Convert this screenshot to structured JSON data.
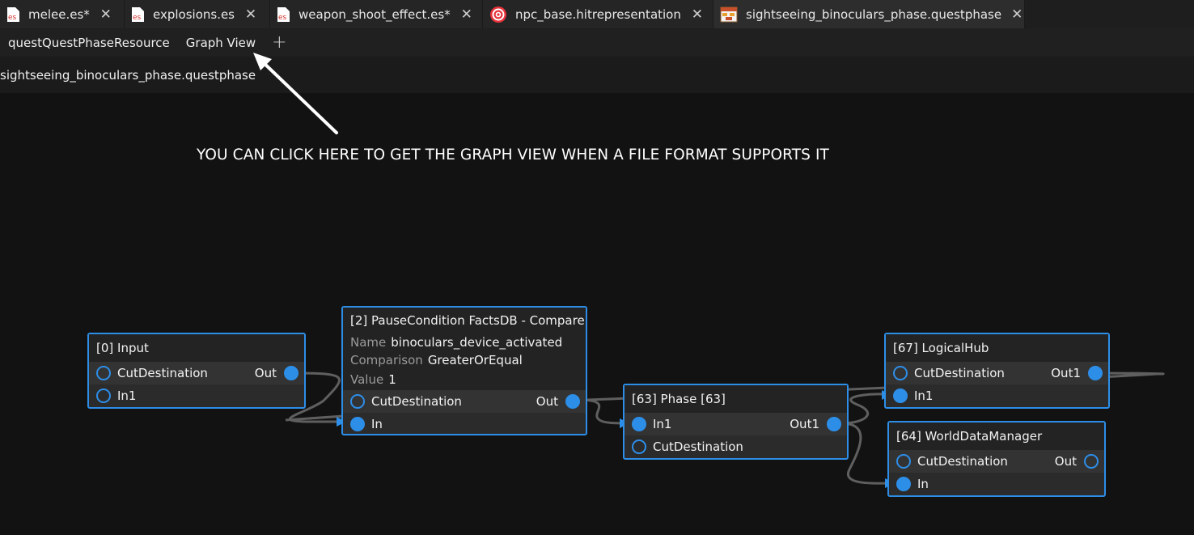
{
  "tabs": [
    {
      "label": "melee.es*",
      "icon": "es-file-icon",
      "active": false
    },
    {
      "label": "explosions.es",
      "icon": "es-file-icon",
      "active": false
    },
    {
      "label": "weapon_shoot_effect.es*",
      "icon": "es-file-icon",
      "active": false
    },
    {
      "label": "npc_base.hitrepresentation",
      "icon": "target-icon",
      "active": false
    },
    {
      "label": "sightseeing_binoculars_phase.questphase",
      "icon": "questphase-icon",
      "active": true
    }
  ],
  "es_icon_text": "es",
  "toolbar": {
    "resource_label": "questQuestPhaseResource",
    "graph_view_label": "Graph View",
    "add_label": "+"
  },
  "path": "sightseeing_binoculars_phase.questphase",
  "annotation": "YOU CAN CLICK HERE TO GET THE GRAPH VIEW WHEN A FILE FORMAT SUPPORTS IT",
  "colors": {
    "accent": "#2d8ee8",
    "background": "#121212",
    "wire": "#5a5a5a"
  },
  "nodes": {
    "input": {
      "title": "[0] Input",
      "rows": [
        {
          "left": "CutDestination",
          "right": "Out"
        },
        {
          "left": "In1",
          "right": ""
        }
      ]
    },
    "pause": {
      "title": "[2] PauseCondition FactsDB - Compare",
      "props": [
        {
          "key": "Name",
          "value": "binoculars_device_activated"
        },
        {
          "key": "Comparison",
          "value": "GreaterOrEqual"
        },
        {
          "key": "Value",
          "value": "1"
        }
      ],
      "rows": [
        {
          "left": "CutDestination",
          "right": "Out"
        },
        {
          "left": "In",
          "right": ""
        }
      ]
    },
    "phase": {
      "title": "[63] Phase [63]",
      "rows": [
        {
          "left": "In1",
          "right": "Out1"
        },
        {
          "left": "CutDestination",
          "right": ""
        }
      ]
    },
    "hub": {
      "title": "[67] LogicalHub",
      "rows": [
        {
          "left": "CutDestination",
          "right": "Out1"
        },
        {
          "left": "In1",
          "right": ""
        }
      ]
    },
    "wdm": {
      "title": "[64] WorldDataManager",
      "rows": [
        {
          "left": "CutDestination",
          "right": "Out"
        },
        {
          "left": "In",
          "right": ""
        }
      ]
    }
  }
}
